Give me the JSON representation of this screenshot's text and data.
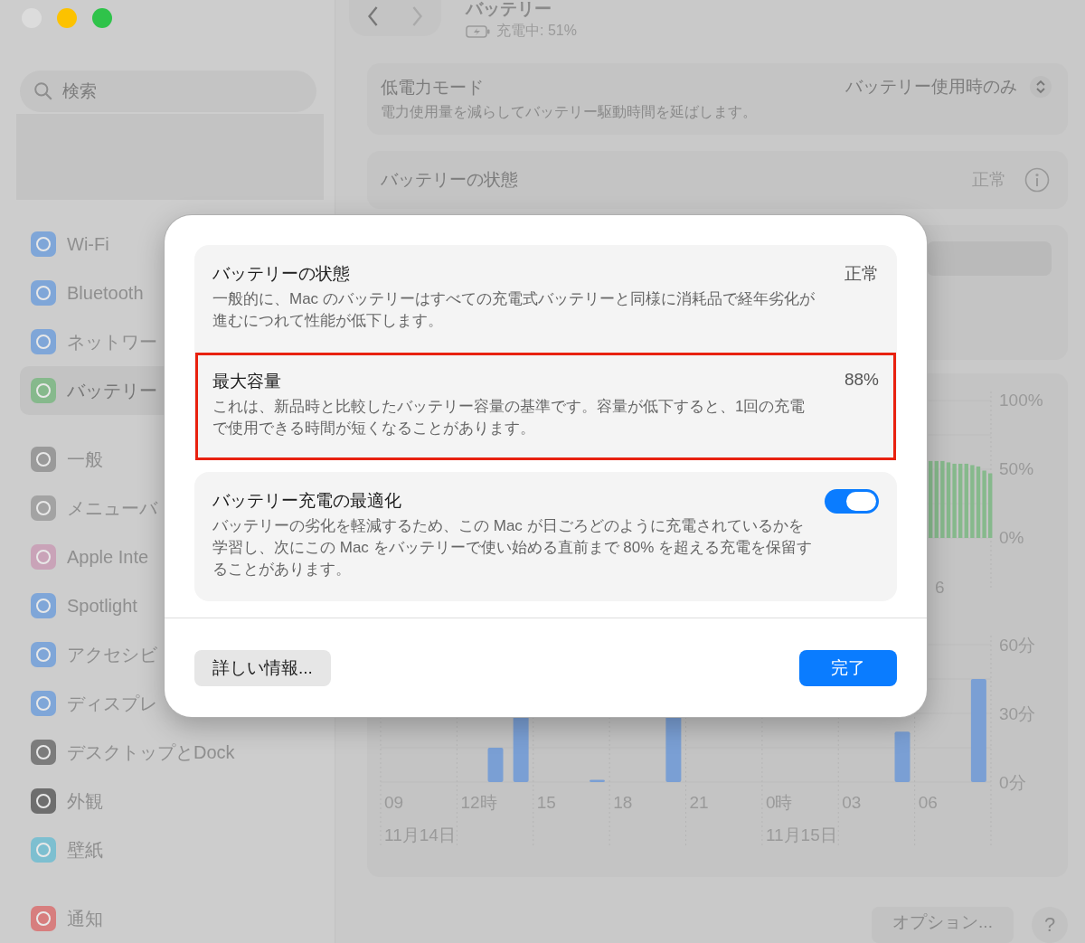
{
  "window": {
    "title": "バッテリー",
    "subtitle": "充電中: 51%"
  },
  "sidebar": {
    "search": {
      "placeholder": "検索"
    },
    "groups": [
      [
        {
          "label": "Wi-Fi",
          "selected": false
        },
        {
          "label": "Bluetooth",
          "selected": false
        },
        {
          "label": "ネットワー",
          "selected": false
        },
        {
          "label": "バッテリー",
          "selected": true
        }
      ],
      [
        {
          "label": "一般",
          "selected": false
        },
        {
          "label": "メニューバ",
          "selected": false
        },
        {
          "label": "Apple Inte",
          "selected": false
        },
        {
          "label": "Spotlight",
          "selected": false
        },
        {
          "label": "アクセシビ",
          "selected": false
        },
        {
          "label": "ディスプレ",
          "selected": false
        },
        {
          "label": "デスクトップとDock",
          "selected": false
        },
        {
          "label": "外観",
          "selected": false
        },
        {
          "label": "壁紙",
          "selected": false
        }
      ],
      [
        {
          "label": "通知",
          "selected": false
        }
      ]
    ]
  },
  "low_power": {
    "title": "低電力モード",
    "description": "電力使用量を減らしてバッテリー駆動時間を延ばします。",
    "value": "バッテリー使用時のみ"
  },
  "battery_health": {
    "title": "バッテリーの状態",
    "value": "正常"
  },
  "battery_level_chart": {
    "ytick_labels": [
      "100%",
      "50%",
      "0%"
    ],
    "xtick_label": "6"
  },
  "usage_chart": {
    "ytick_labels": [
      "60分",
      "30分",
      "0分"
    ],
    "xtick_labels": [
      "09",
      "12時",
      "15",
      "18",
      "21",
      "0時",
      "03",
      "06"
    ],
    "dates": [
      "11月14日",
      "11月15日"
    ]
  },
  "footer_buttons": [
    "オプション...",
    "?"
  ],
  "sheet": {
    "cards": [
      [
        {
          "title": "バッテリーの状態",
          "description": "一般的に、Mac のバッテリーはすべての充電式バッテリーと同様に消耗品で経年劣化が進むにつれて性能が低下します。",
          "value": "正常",
          "kind": "value",
          "highlighted": false
        },
        {
          "title": "最大容量",
          "description": "これは、新品時と比較したバッテリー容量の基準です。容量が低下すると、1回の充電で使用できる時間が短くなることがあります。",
          "value": "88%",
          "kind": "value",
          "highlighted": true
        }
      ],
      [
        {
          "title": "バッテリー充電の最適化",
          "description": "バッテリーの劣化を軽減するため、この Mac が日ごろどのように充電されているかを学習し、次にこの Mac をバッテリーで使い始める直前まで 80% を超える充電を保留することがあります。",
          "on": true,
          "kind": "toggle",
          "highlighted": false
        }
      ]
    ],
    "secondary_button": "詳しい情報...",
    "primary_button": "完了"
  }
}
